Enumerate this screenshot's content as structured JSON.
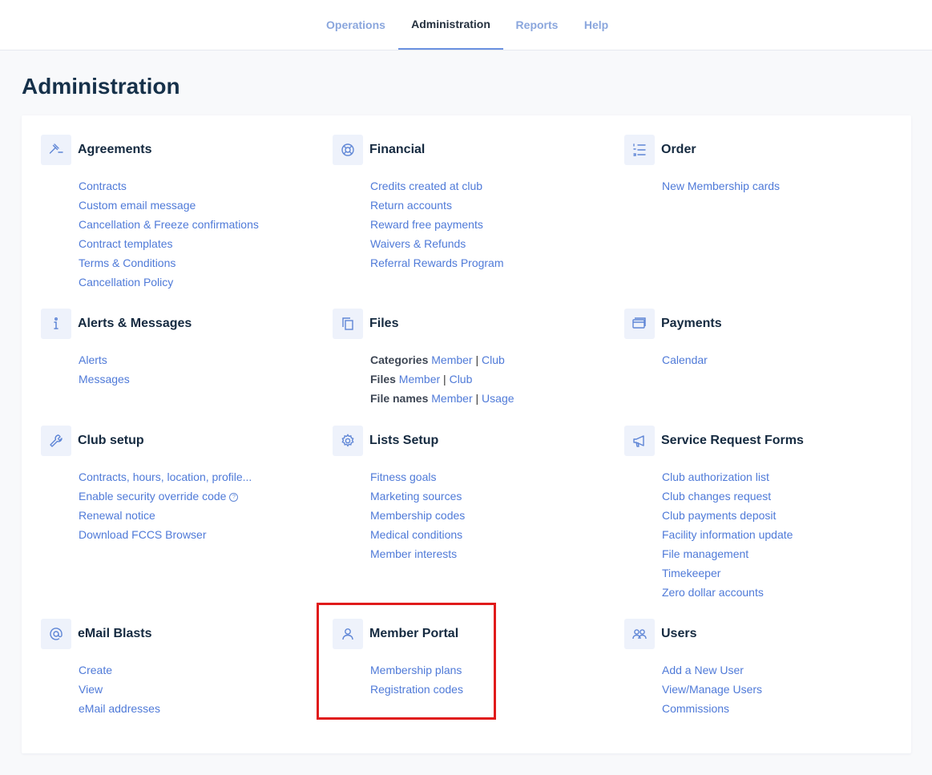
{
  "nav": {
    "tabs": [
      {
        "label": "Operations"
      },
      {
        "label": "Administration"
      },
      {
        "label": "Reports"
      },
      {
        "label": "Help"
      }
    ]
  },
  "page": {
    "title": "Administration"
  },
  "sections": {
    "agreements": {
      "title": "Agreements",
      "icon": "gavel-icon",
      "links": [
        "Contracts",
        "Custom email message",
        "Cancellation & Freeze confirmations",
        "Contract templates",
        "Terms & Conditions",
        "Cancellation Policy"
      ]
    },
    "financial": {
      "title": "Financial",
      "icon": "lifebuoy-icon",
      "links": [
        "Credits created at club",
        "Return accounts",
        "Reward free payments",
        "Waivers & Refunds",
        "Referral Rewards Program"
      ]
    },
    "order": {
      "title": "Order",
      "icon": "list-icon",
      "links": [
        "New Membership cards"
      ]
    },
    "alerts": {
      "title": "Alerts & Messages",
      "icon": "info-icon",
      "links": [
        "Alerts",
        "Messages"
      ]
    },
    "files": {
      "title": "Files",
      "icon": "copy-icon",
      "rows": [
        {
          "label": "Categories",
          "a": "Member",
          "sep": "|",
          "b": "Club"
        },
        {
          "label": "Files",
          "a": "Member",
          "sep": "|",
          "b": "Club"
        },
        {
          "label": "File names",
          "a": "Member",
          "sep": "|",
          "b": "Usage"
        }
      ]
    },
    "payments": {
      "title": "Payments",
      "icon": "cards-icon",
      "links": [
        "Calendar"
      ]
    },
    "club_setup": {
      "title": "Club setup",
      "icon": "wrench-icon",
      "links": [
        "Contracts, hours, location, profile...",
        "Enable security override code",
        "Renewal notice",
        "Download FCCS Browser"
      ],
      "help_glyph": "?"
    },
    "lists_setup": {
      "title": "Lists Setup",
      "icon": "gear-icon",
      "links": [
        "Fitness goals",
        "Marketing sources",
        "Membership codes",
        "Medical conditions",
        "Member interests"
      ]
    },
    "service_request": {
      "title": "Service Request Forms",
      "icon": "megaphone-icon",
      "links": [
        "Club authorization list",
        "Club changes request",
        "Club payments deposit",
        "Facility information update",
        "File management",
        "Timekeeper",
        "Zero dollar accounts"
      ]
    },
    "email_blasts": {
      "title": "eMail Blasts",
      "icon": "at-icon",
      "links": [
        "Create",
        "View",
        "eMail addresses"
      ]
    },
    "member_portal": {
      "title": "Member Portal",
      "icon": "user-icon",
      "links": [
        "Membership plans",
        "Registration codes"
      ]
    },
    "users": {
      "title": "Users",
      "icon": "users-icon",
      "links": [
        "Add a New User",
        "View/Manage Users",
        "Commissions"
      ]
    }
  },
  "colors": {
    "accent": "#4f7ad8",
    "highlight_box": "#e01b1b",
    "title": "#16314a"
  }
}
